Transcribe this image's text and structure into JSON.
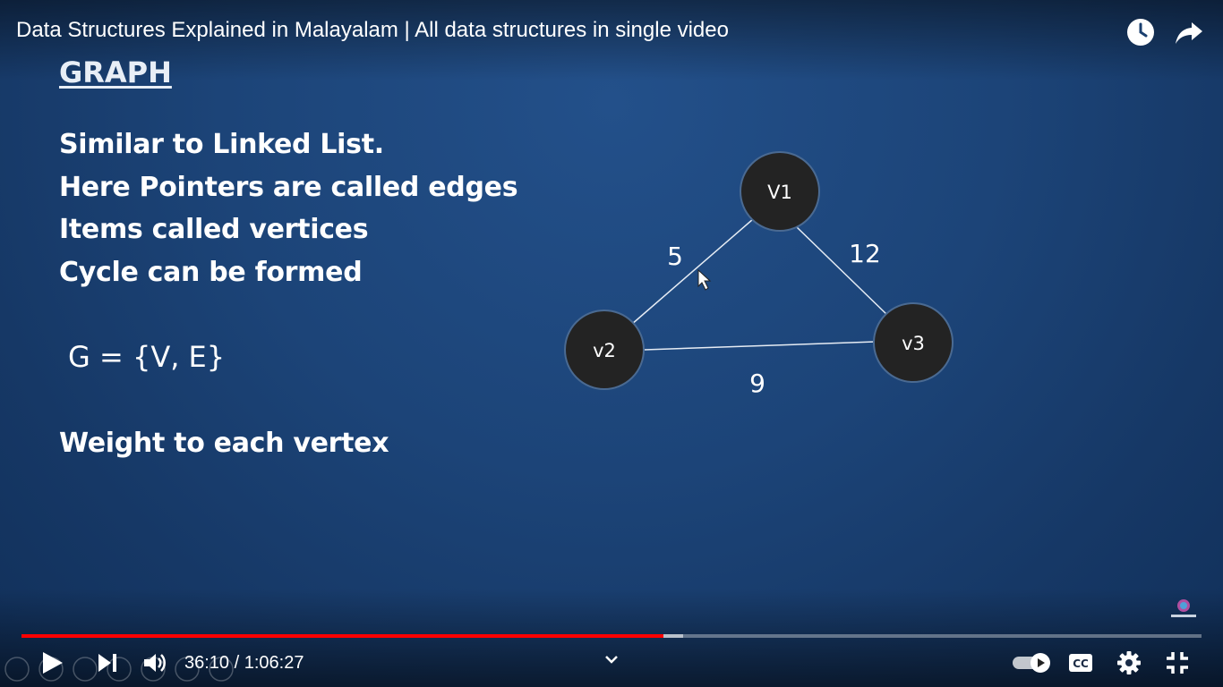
{
  "player": {
    "title": "Data Structures Explained in Malayalam | All data structures in single video",
    "current_time": "36:10",
    "duration": "1:06:27",
    "time_display": "36:10 / 1:06:27",
    "progress": 0.544,
    "buffered": 0.561,
    "accent_color": "#ff0000",
    "icons": {
      "watch_later": "clock-icon",
      "share": "share-arrow-icon",
      "play": "play-icon",
      "next": "next-icon",
      "volume": "volume-icon",
      "chevron": "chevron-down-icon",
      "autoplay": "autoplay-toggle-icon",
      "captions": "cc-icon",
      "settings": "gear-icon",
      "exit_fullscreen": "exit-fullscreen-icon"
    }
  },
  "slide": {
    "heading": "GRAPH",
    "bullets": [
      "Similar to Linked List.",
      "Here Pointers are called edges",
      "Items called vertices",
      "Cycle can be formed"
    ],
    "formula": "G = {V, E}",
    "note": "Weight to each vertex",
    "graph": {
      "vertices": [
        "V1",
        "v2",
        "v3"
      ],
      "edges": [
        {
          "from": "V1",
          "to": "v2",
          "weight": "5"
        },
        {
          "from": "V1",
          "to": "v3",
          "weight": "12"
        },
        {
          "from": "v2",
          "to": "v3",
          "weight": "9"
        }
      ]
    }
  }
}
